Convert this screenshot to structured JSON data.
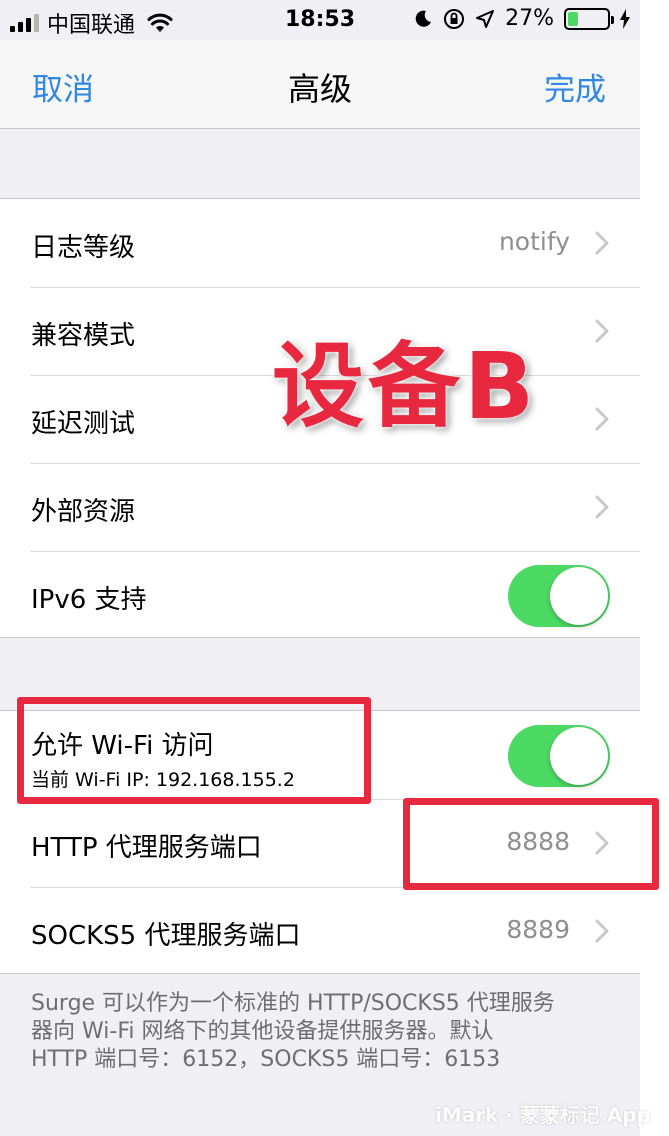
{
  "status_bar": {
    "carrier": "中国联通",
    "time": "18:53",
    "battery_percent": "27%",
    "battery_level": 0.27
  },
  "nav": {
    "cancel": "取消",
    "title": "高级",
    "done": "完成"
  },
  "settings": {
    "log_level": {
      "label": "日志等级",
      "value": "notify"
    },
    "compat_mode": {
      "label": "兼容模式"
    },
    "delay_test": {
      "label": "延迟测试"
    },
    "external_resources": {
      "label": "外部资源"
    },
    "ipv6": {
      "label": "IPv6 支持",
      "enabled": true
    }
  },
  "wifi_access": {
    "label": "允许 Wi-Fi 访问",
    "subtitle": "当前 Wi-Fi IP: 192.168.155.2",
    "enabled": true
  },
  "http_port": {
    "label": "HTTP 代理服务端口",
    "value": "8888"
  },
  "socks5_port": {
    "label": "SOCKS5 代理服务端口",
    "value": "8889"
  },
  "footer": {
    "line1": "Surge 可以作为一个标准的 HTTP/SOCKS5 代理服务",
    "line2": "器向 Wi-Fi 网络下的其他设备提供服务器。默认",
    "line3": "HTTP 端口号：6152，SOCKS5 端口号：6153"
  },
  "annotation": {
    "device_label": "设备B"
  },
  "watermark": "iMark · 蒙蒙标记 App",
  "colors": {
    "accent": "#2f87e6",
    "switch_on": "#4cd964",
    "annotation_red": "#e8283f"
  }
}
